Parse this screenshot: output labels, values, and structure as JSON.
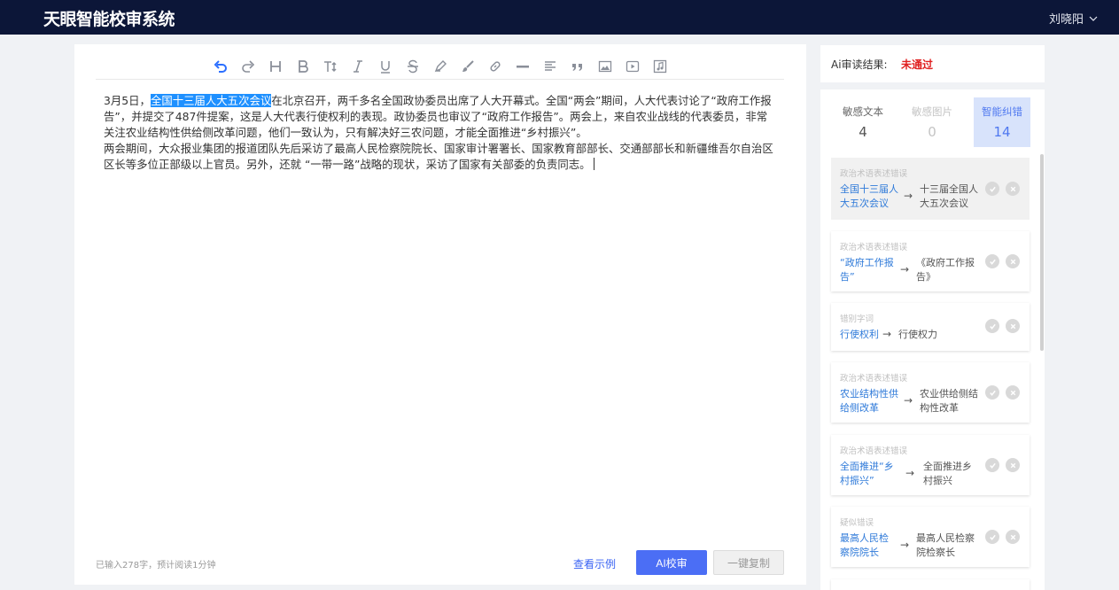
{
  "app": {
    "title": "天眼智能校审系统",
    "user": "刘晓阳"
  },
  "editor": {
    "content": [
      {
        "before": "3月5日，",
        "highlight": "全国十三届人大五次会议",
        "after": "在北京召开，两千多名全国政协委员出席了人大开幕式。全国“两会”期间，人大代表讨论了“政府工作报告”，并提交了487件提案，这是人大代表行使权利的表现。政协委员也审议了“政府工作报告”。两会上，来自农业战线的代表委员，非常关注农业结构性供给侧改革问题，他们一致认为，只有解决好三农问题，才能全面推进“乡村振兴”。"
      },
      {
        "before": "两会期间，大众报业集团的报道团队先后采访了最高人民检察院院长、国家审计署署长、国家教育部部长、交通部部长和新疆维吾尔自治区区长等多位正部级以上官员。另外，还就 “一带一路”战略的现状，采访了国家有关部委的负责同志。"
      }
    ],
    "word_count": "已输入278字，预计阅读1分钟",
    "example_link": "查看示例",
    "ai_button": "AI校审",
    "copy_button": "一键复制"
  },
  "result": {
    "label": "Ai审读结果:",
    "value": "未通过"
  },
  "tabs": [
    {
      "label": "敏感文本",
      "count": "4"
    },
    {
      "label": "敏感图片",
      "count": "0"
    },
    {
      "label": "智能纠错",
      "count": "14"
    }
  ],
  "items": [
    {
      "type": "政治术语表述错误",
      "from": [
        "全国十三届人",
        "大五次会议"
      ],
      "to": [
        "十三届全国人",
        "大五次会议"
      ]
    },
    {
      "type": "政治术语表述错误",
      "from": [
        "“政府工作报",
        "告”"
      ],
      "to": [
        "《政府工作报",
        "告》"
      ]
    },
    {
      "type": "错别字词",
      "from": [
        "行使权利"
      ],
      "to": [
        "行使权力"
      ]
    },
    {
      "type": "政治术语表述错误",
      "from": [
        "农业结构性供",
        "给侧改革"
      ],
      "to": [
        "农业供给侧结",
        "构性改革"
      ]
    },
    {
      "type": "政治术语表述错误",
      "from": [
        "全面推进“乡",
        "村振兴”"
      ],
      "to": [
        "全面推进乡",
        "村振兴"
      ]
    },
    {
      "type": "疑似错误",
      "from": [
        "最高人民检",
        "察院院长"
      ],
      "to": [
        "最高人民检察",
        "院检察长"
      ]
    }
  ],
  "colors": {
    "topbar": "#0c1638",
    "accent": "#4b6ef5",
    "fail": "#e02020",
    "link": "#2f7ad9"
  }
}
